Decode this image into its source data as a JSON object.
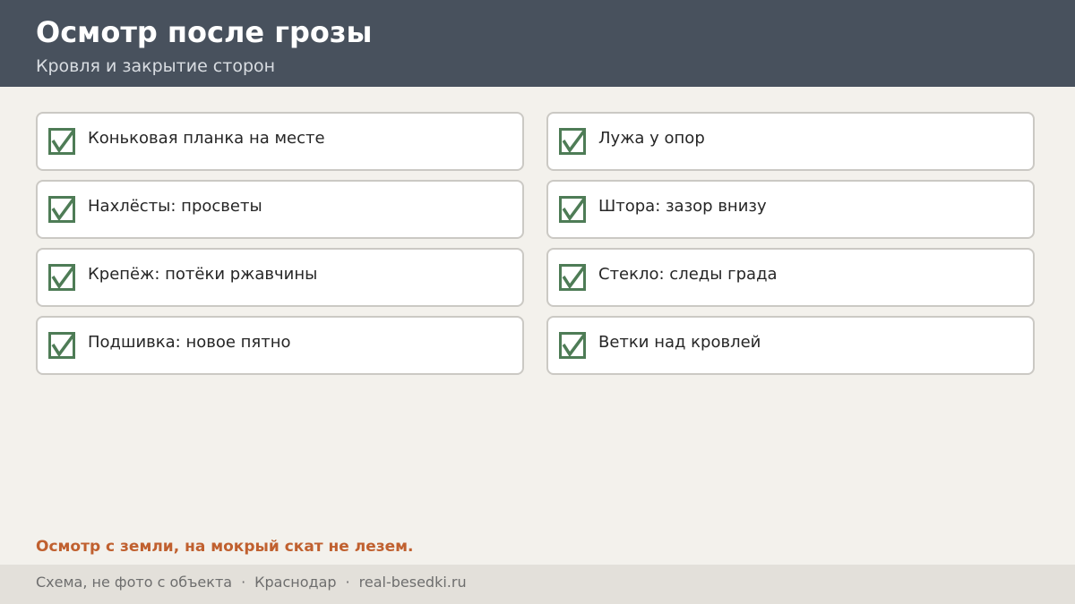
{
  "header": {
    "title": "Осмотр после грозы",
    "subtitle": "Кровля и закрытие сторон"
  },
  "checklist": {
    "check_icon": "checkbox-checked-icon",
    "check_color": "#4e7c56",
    "items": [
      {
        "label": "Коньковая планка на месте",
        "checked": true
      },
      {
        "label": "Лужа у опор",
        "checked": true
      },
      {
        "label": "Нахлёсты: просветы",
        "checked": true
      },
      {
        "label": "Штора: зазор внизу",
        "checked": true
      },
      {
        "label": "Крепёж: потёки ржавчины",
        "checked": true
      },
      {
        "label": "Стекло: следы града",
        "checked": true
      },
      {
        "label": "Подшивка: новое пятно",
        "checked": true
      },
      {
        "label": "Ветки над кровлей",
        "checked": true
      }
    ]
  },
  "warning": {
    "text": "Осмотр с земли, на мокрый скат не лезем.",
    "color": "#c0602f"
  },
  "footer": {
    "note": "Схема, не фото с объекта",
    "separator": "·",
    "city": "Краснодар",
    "site": "real-besedki.ru"
  }
}
